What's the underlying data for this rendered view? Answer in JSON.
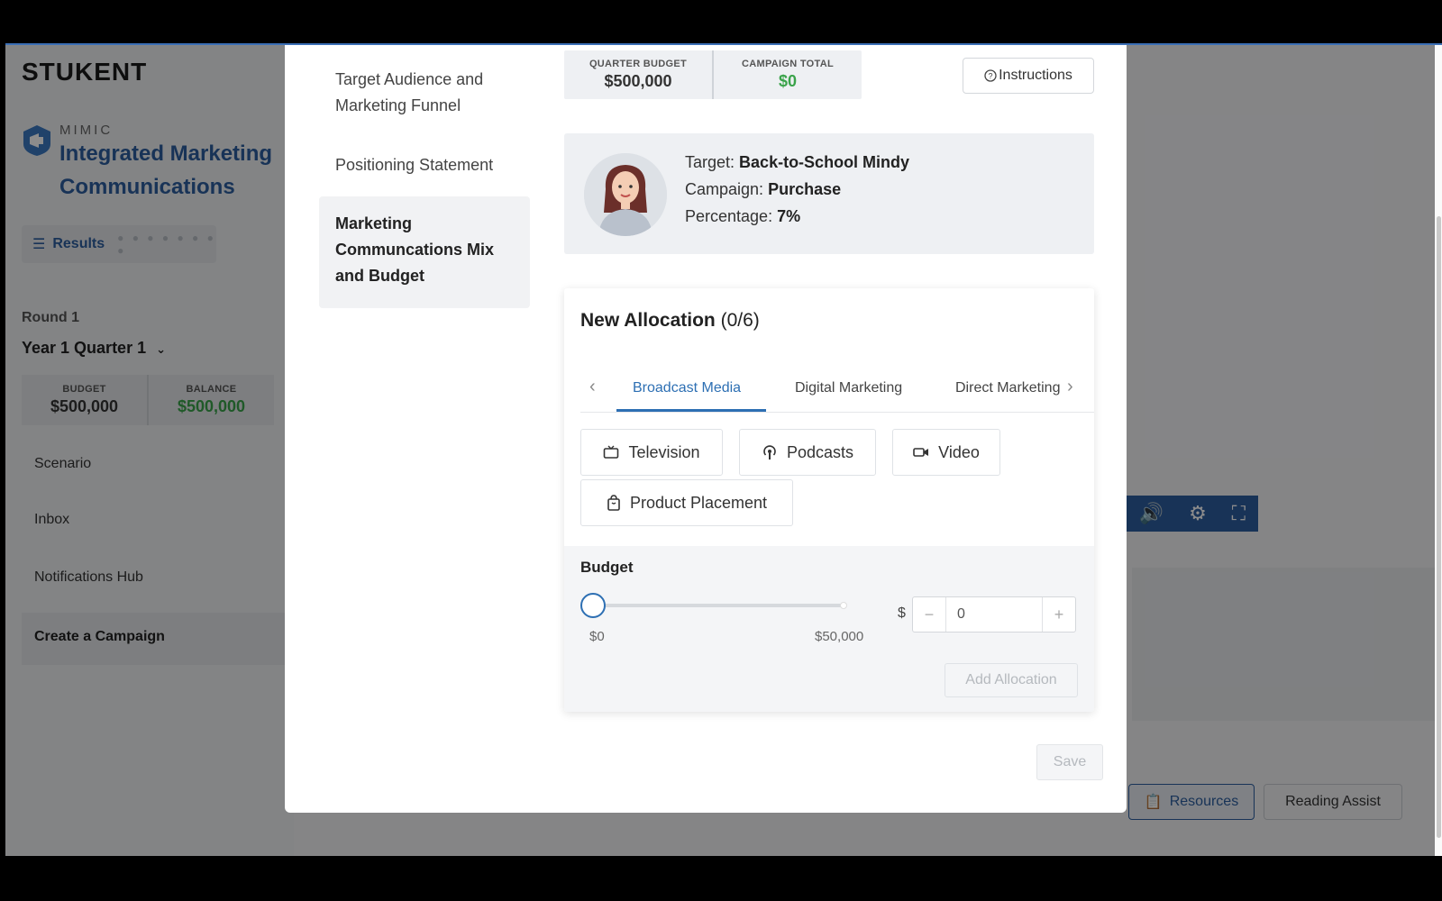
{
  "app": {
    "logo": "STUKENT",
    "mimic_label": "MIMIC",
    "title": "Integrated Marketing Communications"
  },
  "sidebar": {
    "results_label": "Results",
    "round": "Round 1",
    "quarter": "Year 1 Quarter 1",
    "budget_label": "BUDGET",
    "budget_value": "$500,000",
    "balance_label": "BALANCE",
    "balance_value": "$500,000",
    "nav": [
      "Scenario",
      "Inbox",
      "Notifications Hub",
      "Create a Campaign"
    ]
  },
  "footer_buttons": {
    "resources": "Resources",
    "reading_assist": "Reading Assist"
  },
  "modal": {
    "steps": [
      "Target Audience and Marketing Funnel",
      "Positioning Statement",
      "Marketing Communcations Mix and Budget"
    ],
    "quarter_budget_label": "QUARTER BUDGET",
    "quarter_budget_value": "$500,000",
    "campaign_total_label": "CAMPAIGN TOTAL",
    "campaign_total_value": "$0",
    "instructions_label": "Instructions",
    "target": {
      "target_label": "Target:",
      "target_value": "Back-to-School Mindy",
      "campaign_label": "Campaign:",
      "campaign_value": "Purchase",
      "percentage_label": "Percentage:",
      "percentage_value": "7%"
    },
    "allocation": {
      "title": "New Allocation",
      "count": "(0/6)",
      "tabs": [
        "Broadcast Media",
        "Digital Marketing",
        "Direct Marketing"
      ],
      "active_tab": "Broadcast Media",
      "channels": [
        "Television",
        "Podcasts",
        "Video",
        "Product Placement"
      ],
      "budget_label": "Budget",
      "slider_min": "$0",
      "slider_max": "$50,000",
      "slider_value_fraction": 0,
      "currency_symbol": "$",
      "amount_value": "0",
      "add_label": "Add Allocation"
    },
    "save_label": "Save"
  },
  "colors": {
    "accent": "#2d6fb3",
    "brand": "#2d5e9e",
    "positive": "#3aa34a"
  }
}
